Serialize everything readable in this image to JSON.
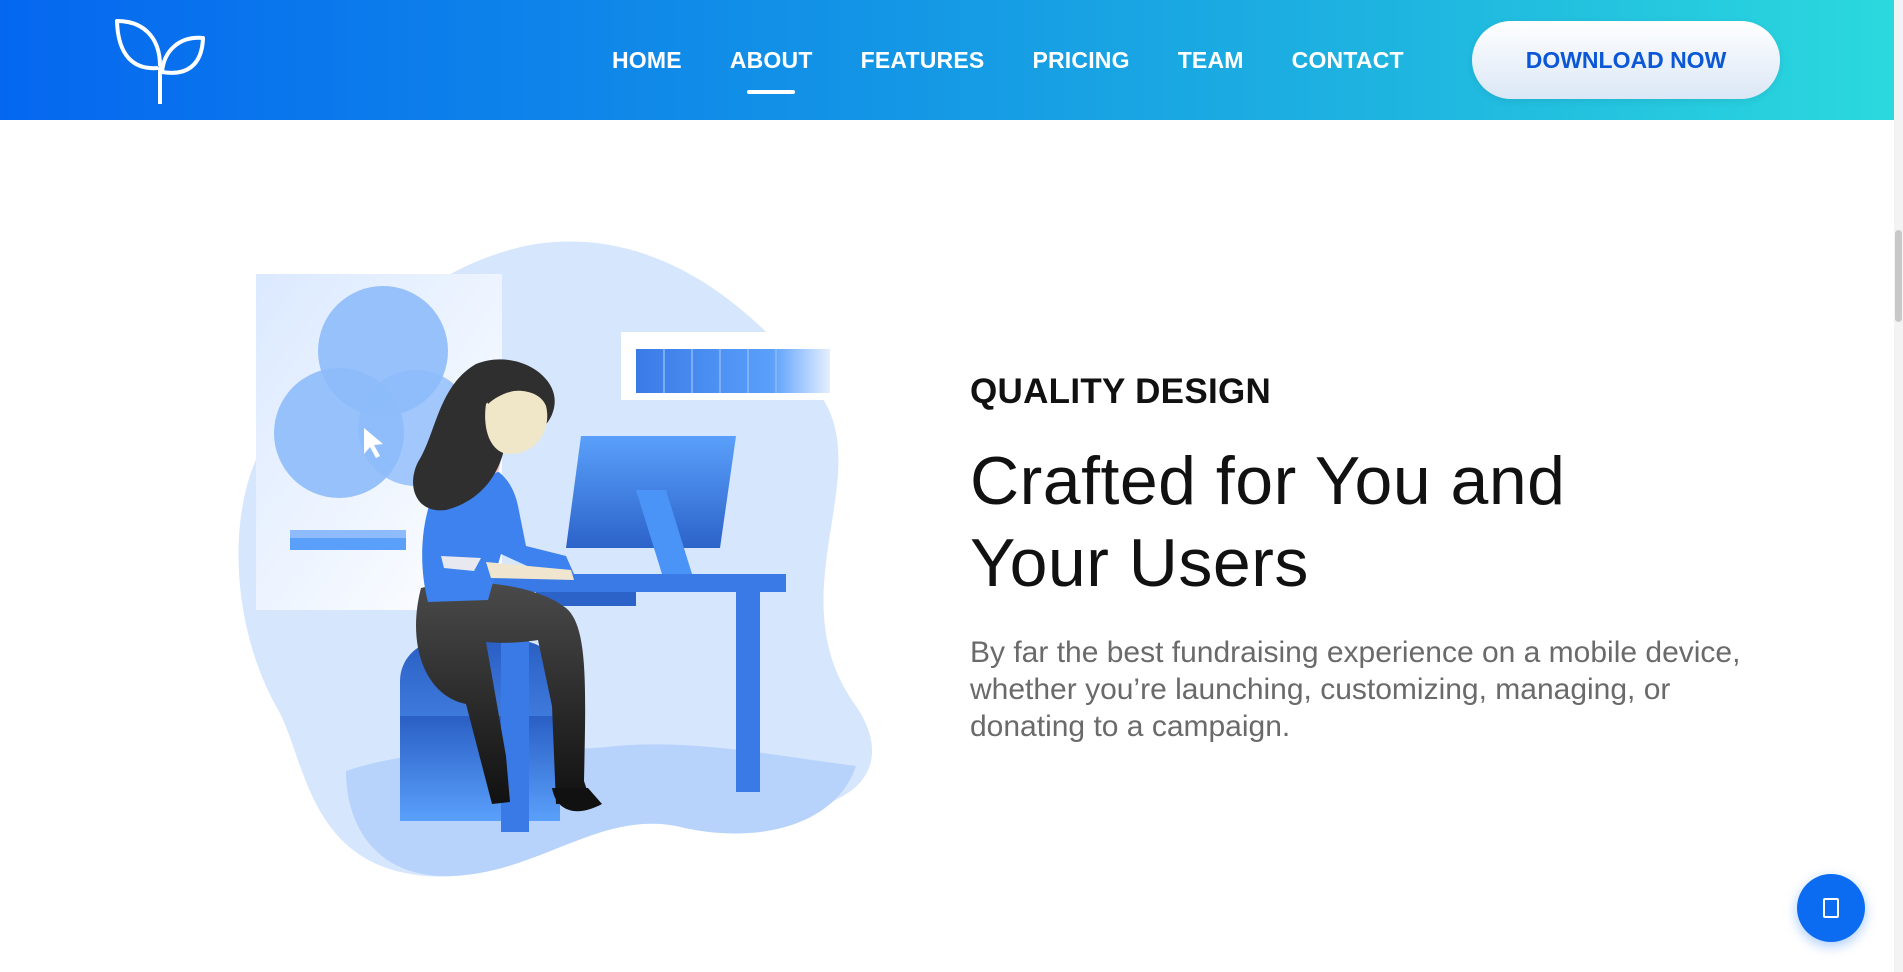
{
  "header": {
    "nav": [
      {
        "label": "HOME",
        "active": false
      },
      {
        "label": "ABOUT",
        "active": true
      },
      {
        "label": "FEATURES",
        "active": false
      },
      {
        "label": "PRICING",
        "active": false
      },
      {
        "label": "TEAM",
        "active": false
      },
      {
        "label": "CONTACT",
        "active": false
      }
    ],
    "cta_label": "DOWNLOAD NOW",
    "logo_icon": "sprout-icon"
  },
  "section": {
    "eyebrow": "QUALITY DESIGN",
    "headline_line1": "Crafted for You and",
    "headline_line2": "Your Users",
    "description": "By far the best fundraising experience on a mobile device, whether you’re launching, customizing, managing, or donating to a campaign."
  },
  "floating_button": {
    "icon": "square-icon"
  },
  "colors": {
    "brand_blue": "#0567f0",
    "brand_cyan": "#2bd9de",
    "illustration_light": "#d6e6fd",
    "illustration_blue": "#4a93f7",
    "button_text": "#0b57d6"
  }
}
